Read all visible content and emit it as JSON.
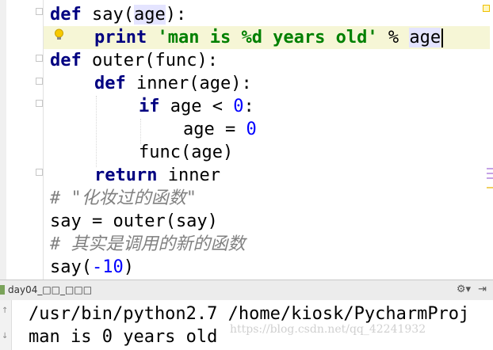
{
  "editor": {
    "lines": [
      {
        "def_kw": "def",
        "fn_name": " say(",
        "param": "age",
        "tail": "):"
      },
      {
        "print_kw": "print",
        "sp": " ",
        "string": "'man is %d years old'",
        "op": " % ",
        "var": "age"
      },
      {
        "def_kw": "def",
        "rest": " outer(func):"
      },
      {
        "def_kw": "def",
        "rest": " inner(age):"
      },
      {
        "if_kw": "if",
        "mid": " age < ",
        "num": "0",
        "tail": ":"
      },
      {
        "mid": "age = ",
        "num": "0"
      },
      {
        "text": "func(age)"
      },
      {
        "return_kw": "return",
        "rest": " inner"
      },
      {
        "comment": "# \"化妆过的函数\""
      },
      {
        "text": "say = outer(say)"
      },
      {
        "comment": "# 其实是调用的新的函数"
      },
      {
        "pre": "say(",
        "num": "-10",
        "tail": ")"
      }
    ]
  },
  "run_panel": {
    "title": "day04_□□_□□□",
    "gear_icon": "gear-icon",
    "hide_icon": "hide-icon"
  },
  "console": {
    "lines": [
      "/usr/bin/python2.7 /home/kiosk/PycharmProj",
      "man is 0 years old"
    ],
    "watermark": "https://blog.csdn.net/qq_42241932"
  },
  "colors": {
    "keyword": "#000080",
    "string": "#008000",
    "number": "#0000ff",
    "comment": "#808080",
    "current_line": "#f6f6d6"
  }
}
